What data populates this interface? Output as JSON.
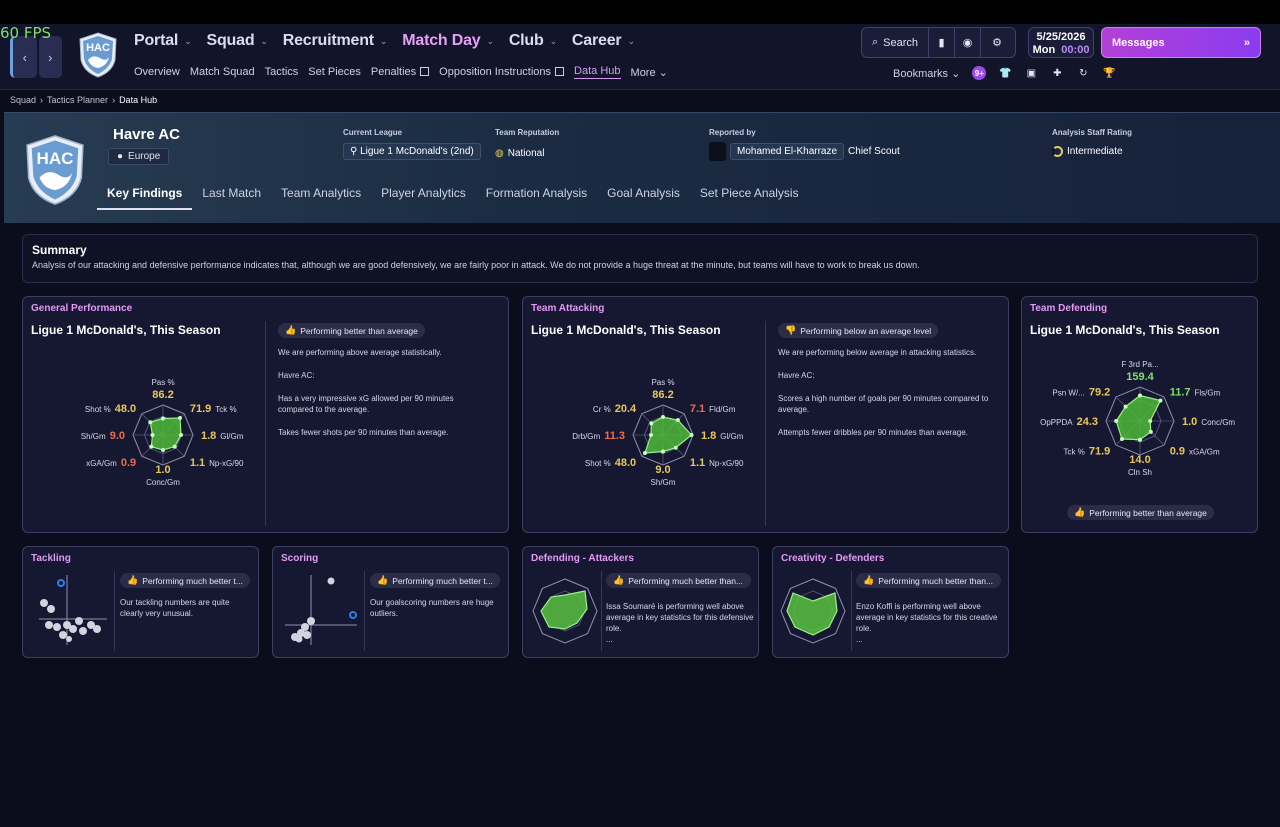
{
  "fps": "60 FPS",
  "nav": {
    "back": "‹",
    "forward": "›",
    "main": [
      "Portal",
      "Squad",
      "Recruitment",
      "Match Day",
      "Club",
      "Career"
    ],
    "sub": [
      "Overview",
      "Match Squad",
      "Tactics",
      "Set Pieces",
      "Penalties",
      "Opposition Instructions",
      "Data Hub",
      "More"
    ],
    "search": "Search",
    "date": "5/25/2026",
    "day": "Mon",
    "time": "00:00",
    "messages": "Messages",
    "bookmarks": "Bookmarks",
    "notif_count": "9+"
  },
  "breadcrumb": [
    "Squad",
    "Tactics Planner",
    "Data Hub"
  ],
  "club": {
    "name": "Havre AC",
    "region": "Europe",
    "logo_text": "HAC",
    "current_league_label": "Current League",
    "current_league": "Ligue 1 McDonald's (2nd)",
    "reputation_label": "Team Reputation",
    "reputation": "National",
    "reported_by_label": "Reported by",
    "reporter": "Mohamed El-Kharraze",
    "reporter_role": "Chief Scout",
    "rating_label": "Analysis Staff Rating",
    "rating": "Intermediate"
  },
  "tabs": [
    "Key Findings",
    "Last Match",
    "Team Analytics",
    "Player Analytics",
    "Formation Analysis",
    "Goal Analysis",
    "Set Piece Analysis"
  ],
  "summary": {
    "title": "Summary",
    "text": "Analysis of our attacking and defensive performance indicates that, although we are good defensively, we are fairly poor in attack. We do not provide a huge threat at the minute, but teams will have to work to break us down."
  },
  "colors": {
    "good": "#7ee06a",
    "mid": "#e8c85a",
    "bad": "#ef6a4a",
    "accent": "#e39af5"
  },
  "cards": {
    "general": {
      "title": "General Performance",
      "subtitle": "Ligue 1 McDonald's, This Season",
      "badge": "Performing better than average",
      "lines": [
        "We are performing above average statistically.",
        "Havre AC:",
        "Has a very impressive xG allowed per 90 minutes compared to the average.",
        "Takes fewer shots per 90 minutes than average."
      ],
      "radar": [
        {
          "label": "Pas %",
          "value": "86.2",
          "color": "mid"
        },
        {
          "label": "Tck %",
          "value": "71.9",
          "color": "mid"
        },
        {
          "label": "Gl/Gm",
          "value": "1.8",
          "color": "mid"
        },
        {
          "label": "Np-xG/90",
          "value": "1.1",
          "color": "mid"
        },
        {
          "label": "Conc/Gm",
          "value": "1.0",
          "color": "mid"
        },
        {
          "label": "xGA/Gm",
          "value": "0.9",
          "color": "bad"
        },
        {
          "label": "Sh/Gm",
          "value": "9.0",
          "color": "bad"
        },
        {
          "label": "Shot %",
          "value": "48.0",
          "color": "mid"
        }
      ]
    },
    "attacking": {
      "title": "Team Attacking",
      "subtitle": "Ligue 1 McDonald's, This Season",
      "badge": "Performing below an average level",
      "lines": [
        "We are performing below average in attacking statistics.",
        "Havre AC:",
        "Scores a high number of goals per 90 minutes compared to average.",
        "Attempts fewer dribbles per 90 minutes than average."
      ],
      "radar": [
        {
          "label": "Pas %",
          "value": "86.2",
          "color": "mid"
        },
        {
          "label": "Fld/Gm",
          "value": "7.1",
          "color": "bad"
        },
        {
          "label": "Gl/Gm",
          "value": "1.8",
          "color": "mid"
        },
        {
          "label": "Np-xG/90",
          "value": "1.1",
          "color": "mid"
        },
        {
          "label": "Sh/Gm",
          "value": "9.0",
          "color": "mid"
        },
        {
          "label": "Shot %",
          "value": "48.0",
          "color": "mid"
        },
        {
          "label": "Drb/Gm",
          "value": "11.3",
          "color": "bad"
        },
        {
          "label": "Cr %",
          "value": "20.4",
          "color": "mid"
        }
      ]
    },
    "defending": {
      "title": "Team Defending",
      "subtitle": "Ligue 1 McDonald's, This Season",
      "badge": "Performing better than average",
      "radar": [
        {
          "label": "F 3rd Pa...",
          "value": "159.4",
          "color": "good"
        },
        {
          "label": "Fls/Gm",
          "value": "11.7",
          "color": "good"
        },
        {
          "label": "Conc/Gm",
          "value": "1.0",
          "color": "mid"
        },
        {
          "label": "xGA/Gm",
          "value": "0.9",
          "color": "mid"
        },
        {
          "label": "Cln Sh",
          "value": "14.0",
          "color": "mid"
        },
        {
          "label": "Tck %",
          "value": "71.9",
          "color": "mid"
        },
        {
          "label": "OpPPDA",
          "value": "24.3",
          "color": "mid"
        },
        {
          "label": "Psn W/...",
          "value": "79.2",
          "color": "mid"
        }
      ]
    },
    "tackling": {
      "title": "Tackling",
      "badge": "Performing much better t...",
      "text": "Our tackling numbers are quite clearly very unusual."
    },
    "scoring": {
      "title": "Scoring",
      "badge": "Performing much better t...",
      "text": "Our goalscoring numbers are huge outliers."
    },
    "def_attackers": {
      "title": "Defending - Attackers",
      "badge": "Performing much better than...",
      "text": "Issa Soumaré is performing well above average in key statistics for this defensive role.",
      "more": "..."
    },
    "creativity": {
      "title": "Creativity - Defenders",
      "badge": "Performing much better than...",
      "text": "Enzo Koffi is performing well above average in key statistics for this creative role.",
      "more": "..."
    }
  }
}
